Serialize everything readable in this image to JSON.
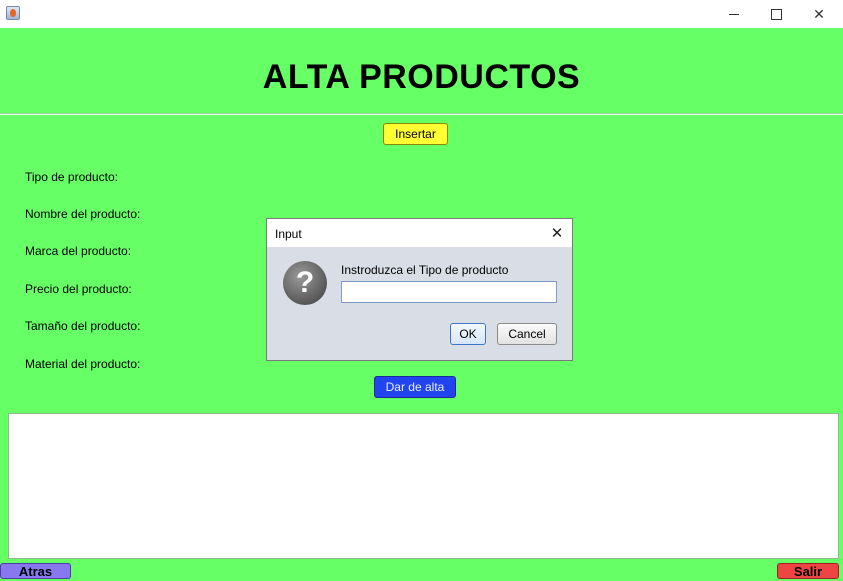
{
  "window": {
    "minimize_icon": "minimize-icon",
    "maximize_icon": "maximize-icon",
    "close_glyph": "✕"
  },
  "main": {
    "title": "ALTA PRODUCTOS",
    "insert_label": "Insertar",
    "fields": [
      "Tipo de producto:",
      "Nombre del producto:",
      "Marca del producto:",
      "Precio del producto:",
      "Tamaño del producto:",
      "Material del producto:"
    ],
    "submit_label": "Dar de alta",
    "output_text": "",
    "back_label": "Atras",
    "exit_label": "Salir"
  },
  "dialog": {
    "title": "Input",
    "close_glyph": "✕",
    "icon_glyph": "?",
    "message": "Instroduzca el Tipo de producto",
    "input_value": "",
    "ok_label": "OK",
    "cancel_label": "Cancel"
  },
  "colors": {
    "background": "#66ff66",
    "insert_button": "#ffff33",
    "submit_button": "#2244ee",
    "back_button": "#8877ee",
    "exit_button": "#ee4444"
  }
}
